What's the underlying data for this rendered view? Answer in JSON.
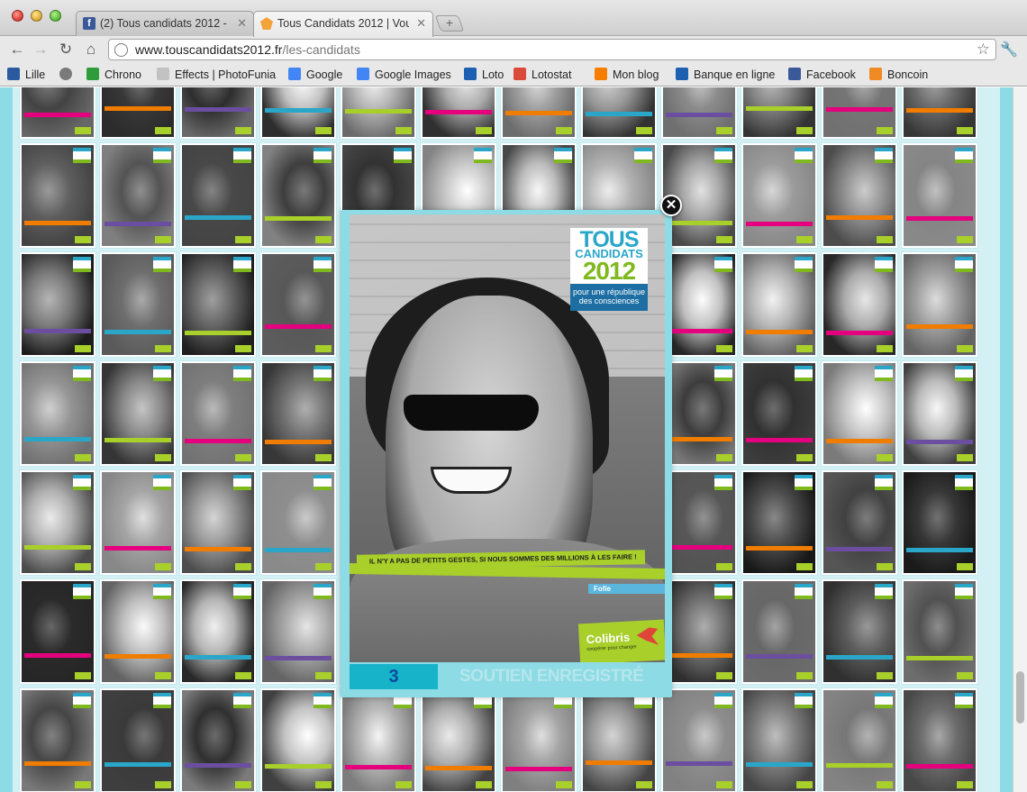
{
  "browser": {
    "tabs": [
      {
        "label": "(2) Tous candidats 2012 - Sc",
        "icon": "facebook-icon",
        "active": false
      },
      {
        "label": "Tous Candidats 2012 | Vous",
        "icon": "tous-candidats-icon",
        "active": true
      }
    ],
    "url_host": "www.touscandidats2012.fr",
    "url_path": "/les-candidats",
    "bookmarks": [
      {
        "label": "Lille",
        "icon": "lille-icon",
        "color": "#2c5aa0"
      },
      {
        "label": "",
        "icon": "globe-icon",
        "color": "#7a7a7a"
      },
      {
        "label": "Chrono",
        "icon": "chrono-icon",
        "color": "#2e9c3a"
      },
      {
        "label": "Effects | PhotoFunia",
        "icon": "photofunia-icon",
        "color": "#c2c2c2"
      },
      {
        "label": "Google",
        "icon": "google-icon",
        "color": "#4285f4"
      },
      {
        "label": "Google Images",
        "icon": "google-images-icon",
        "color": "#4285f4"
      },
      {
        "label": "Loto",
        "icon": "loto-icon",
        "color": "#1d5fb0"
      },
      {
        "label": "Lotostat",
        "icon": "lotostat-icon",
        "color": "#d94a3a"
      },
      {
        "label": "Mon blog",
        "icon": "blogger-icon",
        "color": "#f57d00"
      },
      {
        "label": "Banque en ligne",
        "icon": "bank-icon",
        "color": "#1d5fb0"
      },
      {
        "label": "Facebook",
        "icon": "facebook-icon",
        "color": "#3b5998"
      },
      {
        "label": "Boncoin",
        "icon": "boncoin-icon",
        "color": "#f08a24"
      }
    ]
  },
  "modal": {
    "logo_line1": "TOUS",
    "logo_line2": "CANDIDATS",
    "logo_line3": "2012",
    "logo_sub": "pour une république des consciences",
    "quote": "IL N'Y A PAS DE PETITS GESTES, SI NOUS SOMMES DES MILLIONS À LES FAIRE !",
    "candidate_name": "Fofie",
    "partner_name": "Colibris",
    "partner_tagline": "coopérer pour changer",
    "support_count": "3",
    "support_label": "SOUTIEN ENREGISTRÉ",
    "close_symbol": "✕"
  },
  "grid": {
    "band_colors": [
      "#e5007e",
      "#f07c00",
      "#6b4ea0",
      "#2aa6c8",
      "#a8cf2a",
      "#e5007e",
      "#f07c00",
      "#2aa6c8",
      "#6b4ea0",
      "#a8cf2a",
      "#e5007e",
      "#f07c00"
    ]
  },
  "theme": {
    "page_bg": "#8ddbe4",
    "accent_blue": "#2aa6c8",
    "accent_green": "#a8cf2a"
  }
}
